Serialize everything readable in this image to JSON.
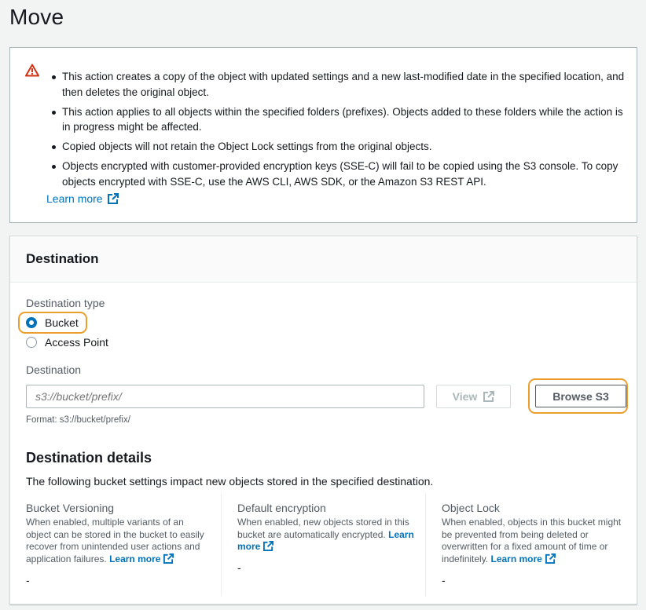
{
  "page": {
    "title": "Move"
  },
  "alert": {
    "items": [
      "This action creates a copy of the object with updated settings and a new last-modified date in the specified location, and then deletes the original object.",
      "This action applies to all objects within the specified folders (prefixes). Objects added to these folders while the action is in progress might be affected.",
      "Copied objects will not retain the Object Lock settings from the original objects.",
      "Objects encrypted with customer-provided encryption keys (SSE-C) will fail to be copied using the S3 console. To copy objects encrypted with SSE-C, use the AWS CLI, AWS SDK, or the Amazon S3 REST API."
    ],
    "learn_more": "Learn more",
    "icon": "warning-icon",
    "icon_color": "#d13212"
  },
  "destination": {
    "title": "Destination",
    "type_label": "Destination type",
    "options": [
      "Bucket",
      "Access Point"
    ],
    "selected": "Bucket",
    "field_label": "Destination",
    "placeholder": "s3://bucket/prefix/",
    "view_label": "View",
    "browse_label": "Browse S3",
    "format_note": "Format: s3://bucket/prefix/"
  },
  "details": {
    "title": "Destination details",
    "description": "The following bucket settings impact new objects stored in the specified destination.",
    "columns": [
      {
        "title": "Bucket Versioning",
        "desc": "When enabled, multiple variants of an object can be stored in the bucket to easily recover from unintended user actions and application failures.",
        "link": "Learn more",
        "value": "-"
      },
      {
        "title": "Default encryption",
        "desc": "When enabled, new objects stored in this bucket are automatically encrypted.",
        "link": "Learn more",
        "value": "-"
      },
      {
        "title": "Object Lock",
        "desc": "When enabled, objects in this bucket might be prevented from being deleted or overwritten for a fixed amount of time or indefinitely.",
        "link": "Learn more",
        "value": "-"
      }
    ]
  },
  "colors": {
    "accent": "#0073bb",
    "highlight": "#ec9e2d"
  }
}
